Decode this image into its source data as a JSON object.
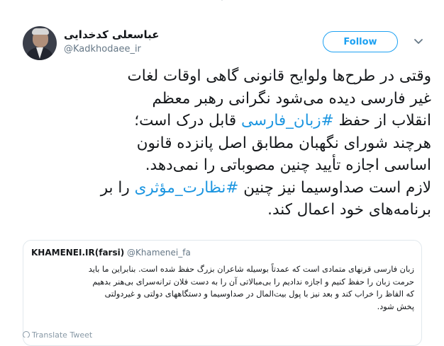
{
  "tweet": {
    "author": {
      "name": "عباسعلی کدخدایی",
      "handle": "@Kadkhodaee_ir"
    },
    "follow_label": "Follow",
    "text_lines": [
      {
        "text": "وقتی در طرح‌ها ولوایح قانونی گاهی اوقات لغات"
      },
      {
        "text": "غیر فارسی دیده می‌شود نگرانی رهبر معظم"
      },
      {
        "before": "انقلاب از حفظ ",
        "hashtag": "#زبان_فارسی",
        "after": " قابل درک است؛"
      },
      {
        "text": "هرچند شورای نگهبان مطابق اصل پانزده قانون"
      },
      {
        "text": "اساسی اجازه تأیید چنین مصوباتی را نمی‌دهد."
      },
      {
        "before": "لازم است صداوسیما نیز چنین ",
        "hashtag": "#نظارت_مؤثری",
        "after": " را بر"
      },
      {
        "text": "برنامه‌های خود اعمال کند."
      }
    ],
    "quote": {
      "name": "KHAMENEI.IR(farsi)",
      "handle": "@Khamenei_fa",
      "lines": [
        "زبان فارسی قرنهای متمادی است که عمدتاً بوسیله شاعران بزرگ حفظ شده است. بنابراین ما باید",
        "حرمت زبان را حفظ کنیم و اجازه ندادیم را بی‌مبالاتی آن را به دست فلان ترانه‌سرای بی‌هنر بدهیم",
        "که الفاظ را خراب کند و بعد نیز با پول بیت‌المال در صداوسیما و دستگاههای دولتی و غیردولتی",
        "پخش شود."
      ]
    },
    "bottom_hint": "Translate Tweet"
  },
  "colors": {
    "link": "#1b95e0",
    "follow_border": "#1da1f2",
    "secondary_text": "#657786",
    "quote_border": "#e1e8ed"
  },
  "icons": {
    "chevron": "chevron-down-icon",
    "globe": "globe-icon"
  }
}
